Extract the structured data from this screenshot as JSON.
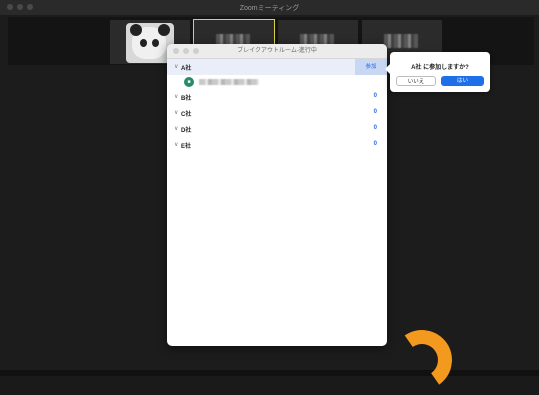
{
  "window": {
    "title": "Zoomミーティング"
  },
  "breakout": {
    "title": "ブレイクアウトルーム-進行中",
    "join_label": "参加",
    "rooms": [
      {
        "name": "A社",
        "count": ""
      },
      {
        "name": "B社",
        "count": "0"
      },
      {
        "name": "C社",
        "count": "0"
      },
      {
        "name": "D社",
        "count": "0"
      },
      {
        "name": "E社",
        "count": "0"
      }
    ]
  },
  "confirm": {
    "question": "A社 に参加しますか?",
    "no_label": "いいえ",
    "yes_label": "はい"
  },
  "colors": {
    "accent": "#1e6fe8",
    "highlight_border": "#d6d34a",
    "orange": "#f39a1e"
  }
}
